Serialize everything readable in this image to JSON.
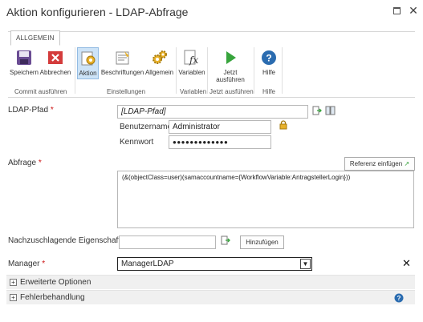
{
  "window": {
    "title": "Aktion konfigurieren - LDAP-Abfrage",
    "maximize_glyph": "",
    "close_glyph": "✕"
  },
  "ribbon": {
    "tab_label": "ALLGEMEIN",
    "buttons": {
      "save": {
        "label": "Speichern",
        "icon": "save-icon"
      },
      "cancel": {
        "label": "Abbrechen",
        "icon": "cancel-icon"
      },
      "action": {
        "label": "Aktion",
        "icon": "action-icon"
      },
      "labels": {
        "label": "Beschriftungen",
        "icon": "labels-icon"
      },
      "general": {
        "label": "Allgemein",
        "icon": "gear-icon"
      },
      "variables": {
        "label": "Variablen",
        "icon": "variables-icon"
      },
      "run_now": {
        "label_line1": "Jetzt",
        "label_line2": "ausführen",
        "icon": "play-icon"
      },
      "help": {
        "label": "Hilfe",
        "icon": "help-icon"
      }
    },
    "groups": {
      "commit": "Commit ausführen",
      "settings": "Einstellungen",
      "variables": "Variablen",
      "run": "Jetzt ausführen",
      "help": "Hilfe"
    }
  },
  "form": {
    "ldap_path": {
      "label": "LDAP-Pfad",
      "required_mark": "*",
      "value": "[LDAP-Pfad]"
    },
    "username": {
      "label": "Benutzername",
      "value": "Administrator"
    },
    "password": {
      "label": "Kennwort",
      "value": "●●●●●●●●●●●●●"
    },
    "query": {
      "label": "Abfrage",
      "required_mark": "*",
      "insert_reference_label": "Referenz einfügen",
      "value": "(&(objectClass=user)(samaccountname={WorkflowVariable:AntragstellerLogin}))"
    },
    "lookup_property": {
      "label": "Nachzuschlagende Eigenschaft",
      "value": "",
      "add_label": "Hinzufügen"
    },
    "manager": {
      "label": "Manager",
      "required_mark": "*",
      "value": "ManagerLDAP",
      "remove_glyph": "✕"
    }
  },
  "sections": {
    "advanced": {
      "label": "Erweiterte Optionen",
      "toggle": "+"
    },
    "error_handling": {
      "label": "Fehlerbehandlung",
      "toggle": "+"
    }
  },
  "colors": {
    "accent_blue": "#2b6cb0",
    "required_red": "#c11111",
    "ribbon_active": "#cde3f7"
  }
}
